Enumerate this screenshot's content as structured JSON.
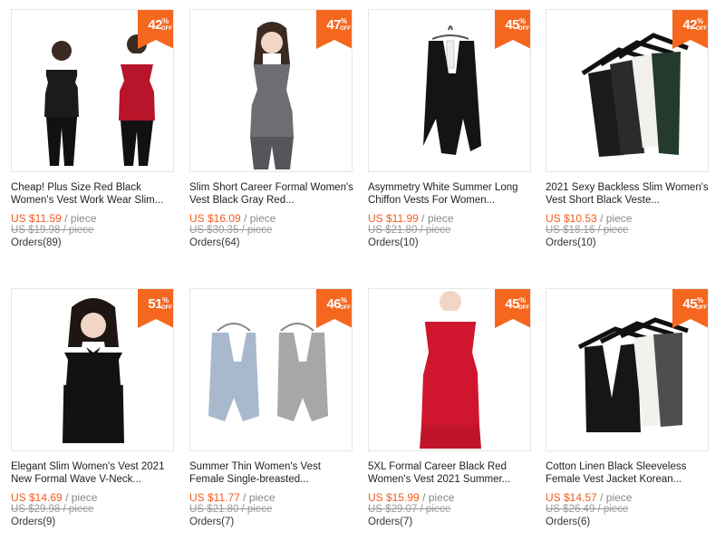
{
  "colors": {
    "accent": "#f55a1e",
    "badge": "#f5671f",
    "text": "#222222",
    "muted": "#999999"
  },
  "products": [
    {
      "discount": "42",
      "pct": "%",
      "off": "OFF",
      "title": "Cheap! Plus Size Red Black Women's Vest Work Wear Slim...",
      "price": "US $11.59",
      "unit": "/ piece",
      "original": "US $19.98 / piece",
      "orders": "Orders(89)",
      "image_icon": "two-women-vests-photo"
    },
    {
      "discount": "47",
      "pct": "%",
      "off": "OFF",
      "title": "Slim Short Career Formal Women's Vest Black Gray Red...",
      "price": "US $16.09",
      "unit": "/ piece",
      "original": "US $30.35 / piece",
      "orders": "Orders(64)",
      "image_icon": "woman-gray-vest-photo"
    },
    {
      "discount": "45",
      "pct": "%",
      "off": "OFF",
      "title": "Asymmetry White Summer Long Chiffon Vests For Women...",
      "price": "US $11.99",
      "unit": "/ piece",
      "original": "US $21.80 / piece",
      "orders": "Orders(10)",
      "image_icon": "black-long-vest-photo"
    },
    {
      "discount": "42",
      "pct": "%",
      "off": "OFF",
      "title": "2021 Sexy Backless Slim Women's Vest Short Black Veste...",
      "price": "US $10.53",
      "unit": "/ piece",
      "original": "US $18.16 / piece",
      "orders": "Orders(10)",
      "image_icon": "vests-on-hangers-photo"
    },
    {
      "discount": "51",
      "pct": "%",
      "off": "OFF",
      "title": "Elegant Slim Women's Vest 2021 New Formal Wave V-Neck...",
      "price": "US $14.69",
      "unit": "/ piece",
      "original": "US $29.98 / piece",
      "orders": "Orders(9)",
      "image_icon": "woman-black-vest-photo"
    },
    {
      "discount": "46",
      "pct": "%",
      "off": "OFF",
      "title": "Summer Thin Women's Vest Female Single-breasted...",
      "price": "US $11.77",
      "unit": "/ piece",
      "original": "US $21.80 / piece",
      "orders": "Orders(7)",
      "image_icon": "halter-vests-photo"
    },
    {
      "discount": "45",
      "pct": "%",
      "off": "OFF",
      "title": "5XL Formal Career Black Red Women's Vest 2021 Summer...",
      "price": "US $15.99",
      "unit": "/ piece",
      "original": "US $29.07 / piece",
      "orders": "Orders(7)",
      "image_icon": "woman-red-vest-photo"
    },
    {
      "discount": "45",
      "pct": "%",
      "off": "OFF",
      "title": "Cotton Linen Black Sleeveless Female Vest Jacket Korean...",
      "price": "US $14.57",
      "unit": "/ piece",
      "original": "US $26.49 / piece",
      "orders": "Orders(6)",
      "image_icon": "vests-on-hangers-photo"
    }
  ]
}
